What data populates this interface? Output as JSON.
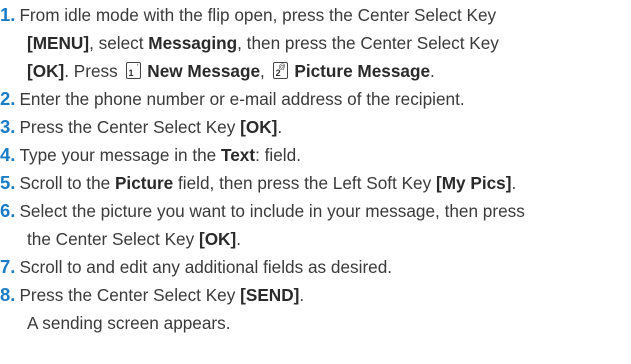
{
  "steps": [
    {
      "number": "1.",
      "line1_pre": "From idle mode with the flip open, press the Center Select Key",
      "line2_menu": "[MENU]",
      "line2_mid": ", select ",
      "line2_messaging": "Messaging",
      "line2_post": ", then press the Center Select Key",
      "line3_ok": "[OK]",
      "line3_press": ". Press ",
      "key1_digit": "1",
      "key1_glyph": "'",
      "line3_new_message": "New Message",
      "line3_comma": ", ",
      "key2_digit": "2",
      "key2_glyph": "@",
      "line3_picture_message": "Picture Message",
      "line3_end": "."
    },
    {
      "number": "2.",
      "text": "Enter the phone number or e-mail address of the recipient."
    },
    {
      "number": "3.",
      "pre": "Press the Center Select Key ",
      "bold": "[OK]",
      "post": "."
    },
    {
      "number": "4.",
      "pre": "Type your message in the ",
      "bold": "Text",
      "post": ": field."
    },
    {
      "number": "5.",
      "pre": "Scroll to the ",
      "bold1": "Picture",
      "mid": " field, then press the Left Soft Key ",
      "bold2": "[My Pics]",
      "post": "."
    },
    {
      "number": "6.",
      "line1": "Select the picture you want to include in your message, then press",
      "line2_pre": "the Center Select Key ",
      "line2_bold": "[OK]",
      "line2_post": "."
    },
    {
      "number": "7.",
      "text": "Scroll to and edit any additional fields as desired."
    },
    {
      "number": "8.",
      "pre": "Press the Center Select Key ",
      "bold": "[SEND]",
      "post": ".",
      "line2": "A sending screen appears."
    }
  ],
  "colors": {
    "step_number": "#1a7cc6",
    "text": "#3a3a3a"
  }
}
